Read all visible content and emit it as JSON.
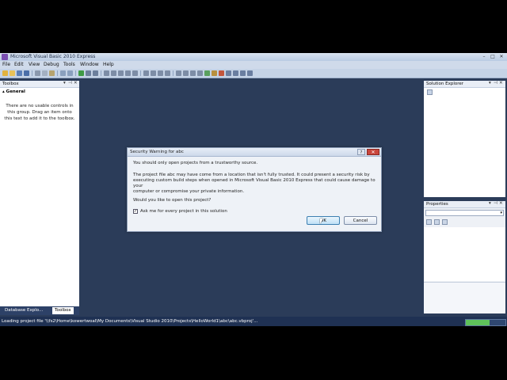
{
  "window": {
    "title": "Microsoft Visual Basic 2010 Express",
    "controls": {
      "minimize": "–",
      "maximize": "□",
      "close": "✕"
    }
  },
  "menu": {
    "items": [
      "File",
      "Edit",
      "View",
      "Debug",
      "Tools",
      "Window",
      "Help"
    ]
  },
  "toolbox": {
    "title": "Toolbox",
    "section": "▴ General",
    "empty_message_lines": [
      "There are no usable controls in",
      "this group. Drag an item onto",
      "this text to add it to the toolbox."
    ]
  },
  "bottom_tabs": {
    "database_explorer": "Database Explo...",
    "toolbox": "Toolbox"
  },
  "solution_explorer": {
    "title": "Solution Explorer"
  },
  "properties": {
    "title": "Properties"
  },
  "dialog": {
    "title": "Security Warning for abc",
    "line1": "You should only open projects from a trustworthy source.",
    "para_lines": [
      "The project file abc may have come from a location that isn't fully trusted. It could present a security risk by",
      "executing custom build steps when opened in Microsoft Visual Basic 2010 Express that could cause damage to your",
      "computer or compromise your private information."
    ],
    "question": "Would you like to open this project?",
    "checkbox_label": "Ask me for every project in this solution",
    "checkbox_checked": true,
    "ok_label": "OK",
    "cancel_label": "Cancel"
  },
  "status": {
    "text": "Loading project file '\\\\fs2\\Home\\kowertwoal\\My Documents\\Visual Studio 2010\\Projects\\HelloWorld1\\abc\\abc.vbproj'...",
    "progress": 0.6
  },
  "colors": {
    "ide_background": "#2b3c59",
    "accent": "#3c7fb1"
  }
}
